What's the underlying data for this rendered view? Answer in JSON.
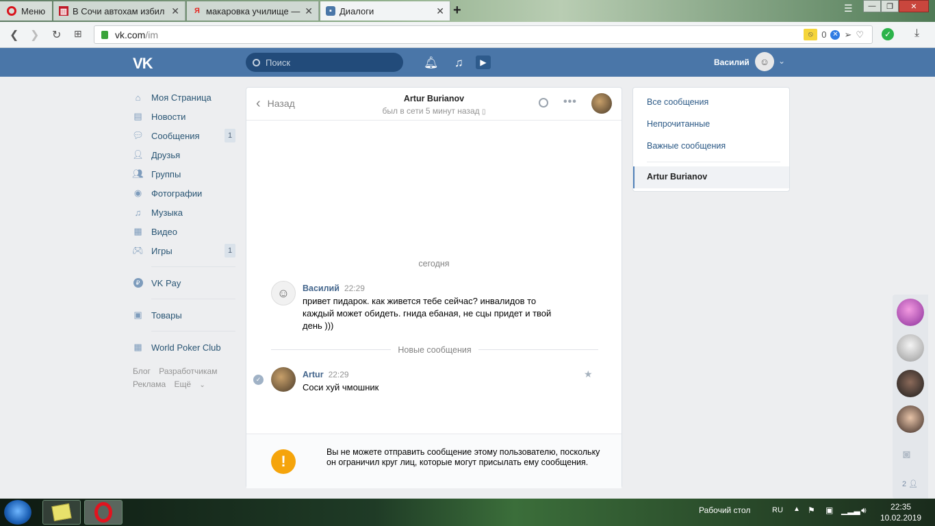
{
  "browser": {
    "menu_label": "Меню",
    "tabs": [
      {
        "title": "В Сочи автохам избил ин"
      },
      {
        "title": "макаровка училище — Я"
      },
      {
        "title": "Диалоги"
      }
    ],
    "url_host": "vk.com",
    "url_path": "/im",
    "vpn_count": "0"
  },
  "vk": {
    "logo": "VK",
    "search_placeholder": "Поиск",
    "user_name": "Василий"
  },
  "left_menu": {
    "items": [
      {
        "label": "Моя Страница",
        "icon": "home-icon"
      },
      {
        "label": "Новости",
        "icon": "news-icon"
      },
      {
        "label": "Сообщения",
        "icon": "messages-icon",
        "badge": "1"
      },
      {
        "label": "Друзья",
        "icon": "friends-icon"
      },
      {
        "label": "Группы",
        "icon": "groups-icon"
      },
      {
        "label": "Фотографии",
        "icon": "camera-icon"
      },
      {
        "label": "Музыка",
        "icon": "music-icon"
      },
      {
        "label": "Видео",
        "icon": "video-icon"
      },
      {
        "label": "Игры",
        "icon": "games-icon",
        "badge": "1"
      },
      {
        "label": "VK Pay",
        "icon": "vkpay-icon"
      },
      {
        "label": "Товары",
        "icon": "bag-icon"
      },
      {
        "label": "World Poker Club",
        "icon": "app-icon"
      }
    ],
    "footer": [
      "Блог",
      "Разработчикам",
      "Реклама",
      "Ещё"
    ]
  },
  "chat": {
    "back_label": "Назад",
    "peer_name": "Artur Burianov",
    "peer_status": "был в сети 5 минут назад",
    "day_label": "сегодня",
    "new_messages_label": "Новые сообщения",
    "messages": [
      {
        "author": "Василий",
        "time": "22:29",
        "text": "привет пидарок. как живется тебе сейчас? инвалидов то каждый может обидеть. гнида ебаная, не сцы придет и твой день )))"
      },
      {
        "author": "Artur",
        "time": "22:29",
        "text": "Соси хуй чмошник"
      }
    ],
    "blocked_notice": "Вы не можете отправить сообщение этому пользователю, поскольку он ограничил круг лиц, которые могут присылать ему сообщения."
  },
  "right_panel": {
    "filters": [
      "Все сообщения",
      "Непрочитанные",
      "Важные сообщения"
    ],
    "active_conversation": "Artur Burianov"
  },
  "friends_strip": {
    "count": "2"
  },
  "taskbar": {
    "desktop_label": "Рабочий стол",
    "lang": "RU",
    "time": "22:35",
    "date": "10.02.2019"
  },
  "colors": {
    "vk_header": "#4a76a8",
    "vk_link": "#2a5885",
    "warning": "#f5a40b"
  }
}
